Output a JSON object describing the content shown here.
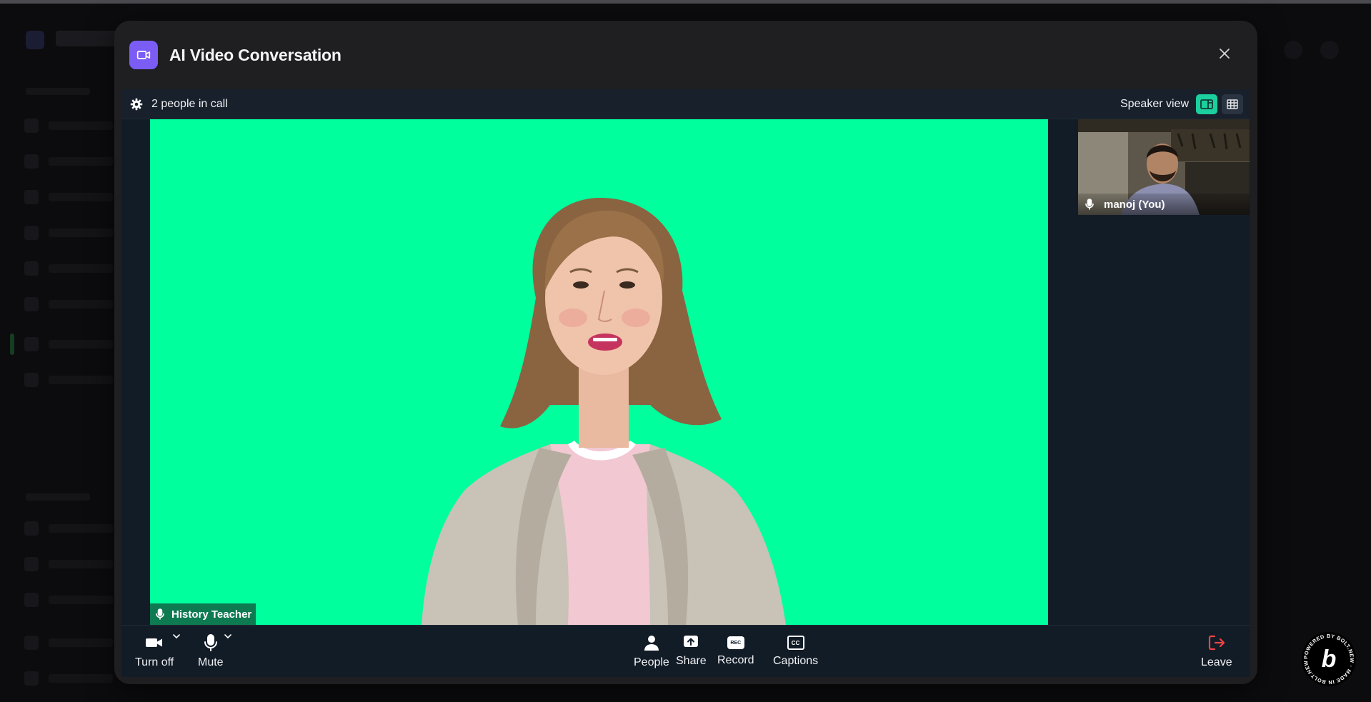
{
  "modal": {
    "title": "AI Video Conversation",
    "header_icon": "video-camera-icon",
    "close_icon": "close-icon"
  },
  "call": {
    "people_in_call": "2 people in call",
    "view_label": "Speaker view",
    "active_view": "speaker",
    "main_participant": "History Teacher",
    "self_participant": "manoj (You)"
  },
  "controls": {
    "camera": "Turn off",
    "mute": "Mute",
    "people": "People",
    "share": "Share",
    "record": "Record",
    "record_badge": "REC",
    "captions": "Captions",
    "captions_badge": "CC",
    "leave": "Leave"
  },
  "badge": {
    "text": "POWERED BY BOLT.NEW · MADE IN BOLT.NEW ·",
    "letter": "b"
  },
  "colors": {
    "accent": "#7b5cf5",
    "green_screen": "#00ff9d",
    "active_view": "#1ccf9f",
    "leave_red": "#ef4444"
  }
}
